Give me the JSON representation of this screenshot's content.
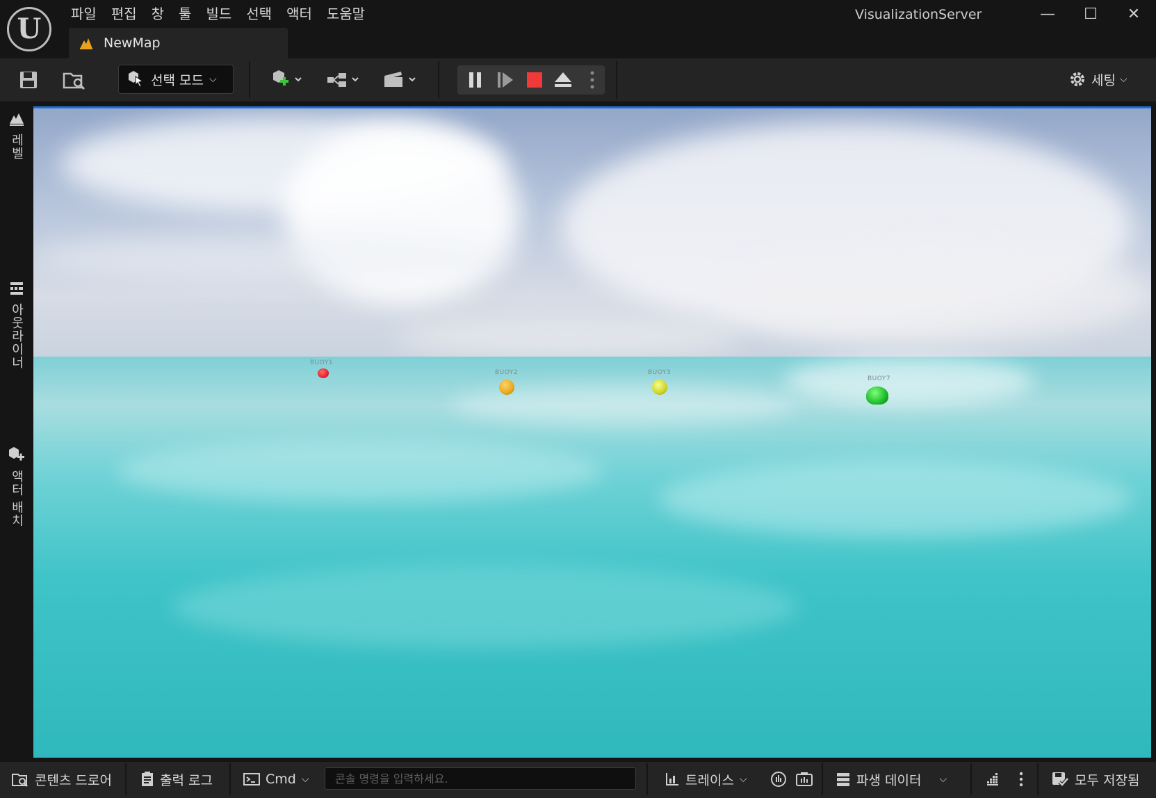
{
  "app": {
    "logo_text": "U",
    "title": "VisualizationServer"
  },
  "menu": [
    "파일",
    "편집",
    "창",
    "툴",
    "빌드",
    "선택",
    "액터",
    "도움말"
  ],
  "window_controls": {
    "minimize": "—",
    "maximize": "☐",
    "close": "✕"
  },
  "document_tab": {
    "label": "NewMap"
  },
  "toolbar": {
    "mode_label": "선택 모드",
    "settings_label": "세팅"
  },
  "left_panel": {
    "tabs": [
      "레벨",
      "아웃라이너",
      "액터 배치"
    ]
  },
  "viewport": {
    "buoys": [
      {
        "label": "BUOY1",
        "color": "#e8232f"
      },
      {
        "label": "BUOY2",
        "color": "#e8a91c"
      },
      {
        "label": "BUOY3",
        "color": "#cfd52a"
      },
      {
        "label": "BUOY7",
        "color": "#1fbd2c"
      }
    ]
  },
  "bottom_bar": {
    "content_drawer": "콘텐츠 드로어",
    "output_log": "출력 로그",
    "cmd": "Cmd",
    "console_placeholder": "콘솔 명령을 입력하세요.",
    "trace": "트레이스",
    "derived_data": "파생 데이터",
    "save_all": "모두 저장됨"
  },
  "colors": {
    "accent": "#1f6fd6",
    "stop_button": "#f03a3a",
    "tab_icon": "#e8a21c"
  }
}
